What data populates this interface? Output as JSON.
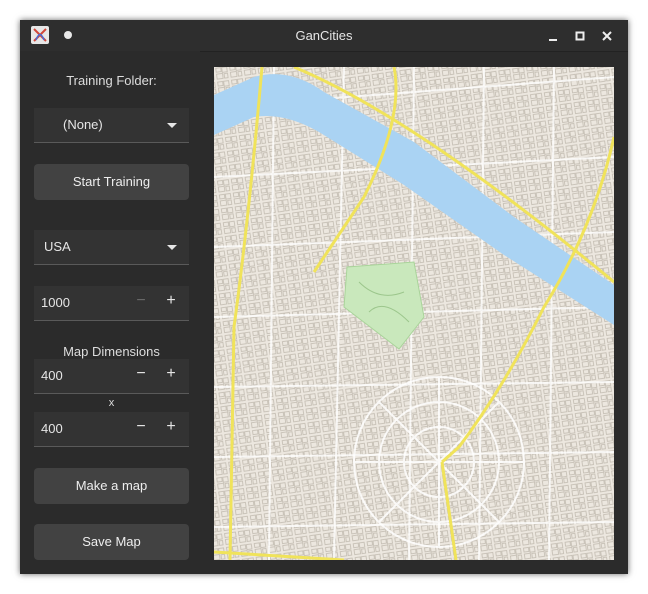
{
  "window": {
    "title": "GanCities"
  },
  "sidebar": {
    "training_folder_label": "Training Folder:",
    "training_folder_value": "(None)",
    "start_training_label": "Start Training",
    "region_value": "USA",
    "iterations_value": "1000",
    "map_dimensions_label": "Map Dimensions",
    "width_value": "400",
    "separator": "x",
    "height_value": "400",
    "make_map_label": "Make a map",
    "save_map_label": "Save Map"
  },
  "icons": {
    "app": "app-logo-icon",
    "indicator": "dot-icon",
    "minimize": "minimize-icon",
    "maximize": "maximize-icon",
    "close": "close-icon",
    "dropdown": "chevron-down-icon"
  },
  "colors": {
    "window_bg": "#2b2b2b",
    "button_bg": "#424242",
    "map_land": "#ece7df",
    "map_water": "#aad3f3",
    "map_park": "#c9e8bc",
    "map_road": "#f0e35a",
    "map_block": "#d8d2c7"
  }
}
